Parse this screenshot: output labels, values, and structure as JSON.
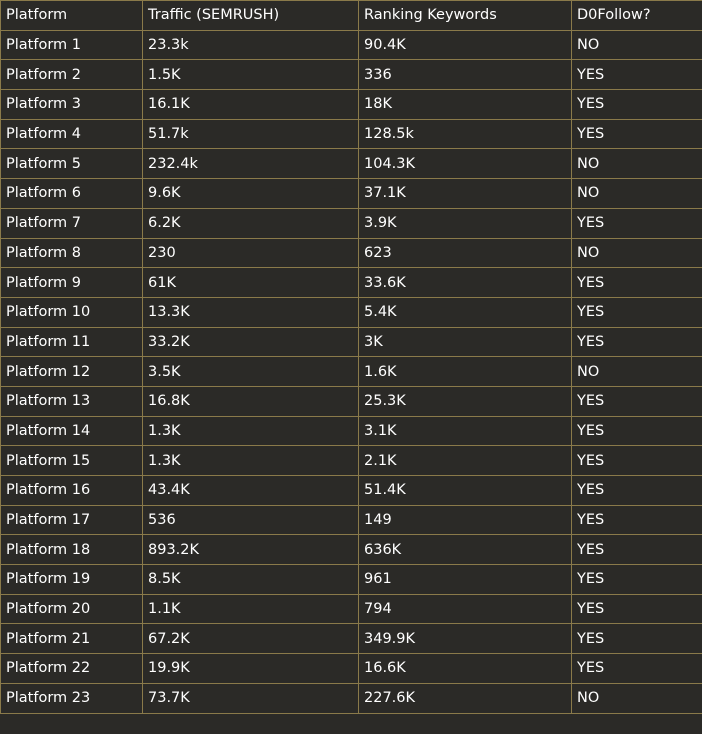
{
  "table": {
    "headers": [
      "Platform",
      "Traffic (SEMRUSH)",
      "Ranking Keywords",
      "D0Follow?"
    ],
    "rows": [
      [
        "Platform 1",
        "23.3k",
        "90.4K",
        "NO"
      ],
      [
        "Platform 2",
        "1.5K",
        "336",
        "YES"
      ],
      [
        "Platform 3",
        "16.1K",
        "18K",
        "YES"
      ],
      [
        "Platform 4",
        "51.7k",
        "128.5k",
        "YES"
      ],
      [
        "Platform 5",
        "232.4k",
        "104.3K",
        "NO"
      ],
      [
        "Platform 6",
        "9.6K",
        "37.1K",
        "NO"
      ],
      [
        "Platform 7",
        "6.2K",
        "3.9K",
        "YES"
      ],
      [
        "Platform 8",
        "230",
        "623",
        "NO"
      ],
      [
        "Platform 9",
        "61K",
        "33.6K",
        "YES"
      ],
      [
        "Platform 10",
        "13.3K",
        "5.4K",
        "YES"
      ],
      [
        "Platform 11",
        "33.2K",
        "3K",
        "YES"
      ],
      [
        "Platform 12",
        "3.5K",
        "1.6K",
        "NO"
      ],
      [
        "Platform 13",
        "16.8K",
        "25.3K",
        "YES"
      ],
      [
        "Platform 14",
        "1.3K",
        "3.1K",
        "YES"
      ],
      [
        "Platform 15",
        "1.3K",
        "2.1K",
        "YES"
      ],
      [
        "Platform 16",
        "43.4K",
        "51.4K",
        "YES"
      ],
      [
        "Platform 17",
        "536",
        "149",
        "YES"
      ],
      [
        "Platform 18",
        "893.2K",
        "636K",
        "YES"
      ],
      [
        "Platform 19",
        "8.5K",
        "961",
        "YES"
      ],
      [
        "Platform 20",
        "1.1K",
        "794",
        "YES"
      ],
      [
        "Platform 21",
        "67.2K",
        "349.9K",
        "YES"
      ],
      [
        "Platform 22",
        "19.9K",
        "16.6K",
        "YES"
      ],
      [
        "Platform 23",
        "73.7K",
        "227.6K",
        "NO"
      ]
    ]
  }
}
